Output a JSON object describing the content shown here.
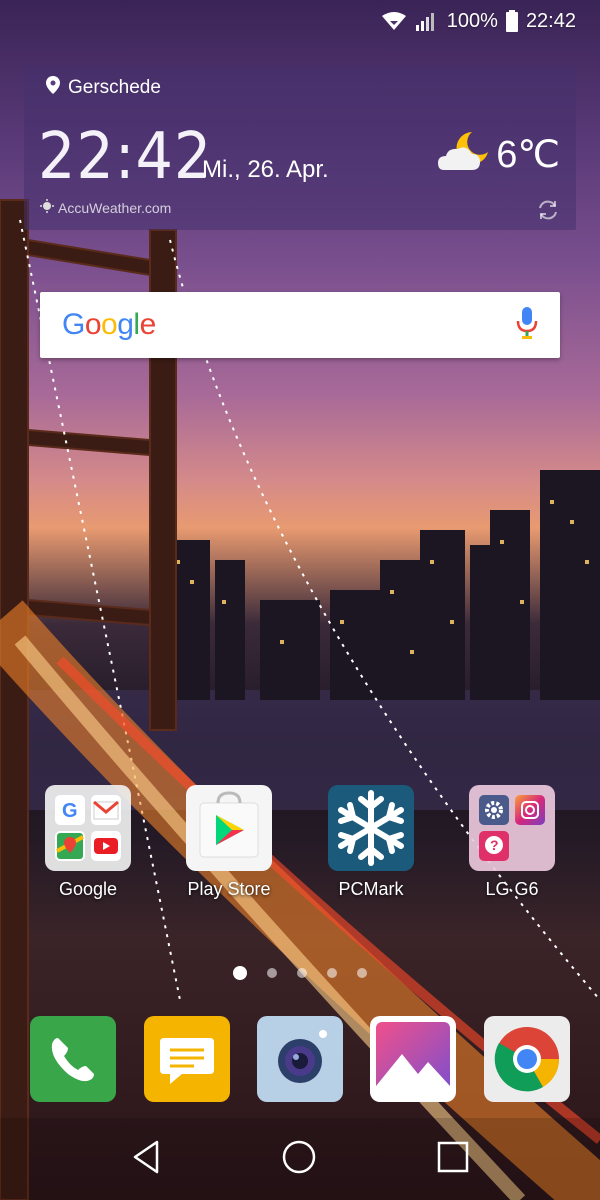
{
  "status_bar": {
    "battery": "100%",
    "time": "22:42"
  },
  "weather": {
    "location": "Gerschede",
    "time": "22:42",
    "date": "Mi., 26. Apr.",
    "temperature": "6℃",
    "condition_icon": "moon-cloud-icon",
    "source": "AccuWeather.com"
  },
  "search": {
    "logo_text": "Google",
    "logo_colors": [
      "#4285F4",
      "#EA4335",
      "#FBBC05",
      "#4285F4",
      "#34A853",
      "#EA4335"
    ],
    "mic_icon": "microphone-icon"
  },
  "apps": [
    {
      "label": "Google",
      "type": "folder"
    },
    {
      "label": "Play Store",
      "type": "app"
    },
    {
      "label": "PCMark",
      "type": "app"
    },
    {
      "label": "LG G6",
      "type": "folder"
    }
  ],
  "page_indicator": {
    "pages": 5,
    "active_index": 0
  },
  "dock": [
    {
      "name": "phone",
      "icon": "phone-icon",
      "color": "#3aa64a"
    },
    {
      "name": "messages",
      "icon": "message-icon",
      "color": "#f5b400"
    },
    {
      "name": "camera",
      "icon": "camera-icon",
      "color": "#a9c6e0"
    },
    {
      "name": "gallery",
      "icon": "gallery-icon",
      "color": "#ffffff"
    },
    {
      "name": "chrome",
      "icon": "chrome-icon",
      "color": "#ececec"
    }
  ],
  "nav": {
    "back_icon": "back-icon",
    "home_icon": "home-icon",
    "recents_icon": "recents-icon"
  }
}
